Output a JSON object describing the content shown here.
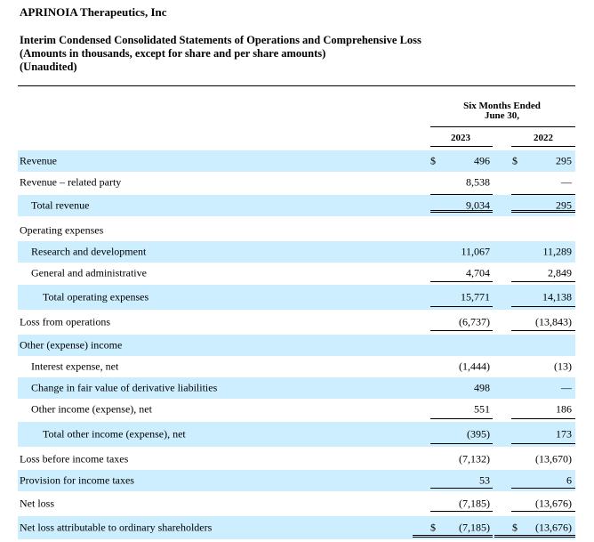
{
  "header": {
    "company": "APRINOIA Therapeutics, Inc",
    "title": "Interim Condensed Consolidated Statements of Operations and Comprehensive Loss",
    "subtitle": "(Amounts in thousands, except for share and per share amounts)",
    "note": "(Unaudited)"
  },
  "columns": {
    "period_line1": "Six Months Ended",
    "period_line2": "June 30,",
    "year1": "2023",
    "year2": "2022"
  },
  "rows": [
    {
      "label": "Revenue",
      "cur1": "$",
      "v1": "496",
      "cur2": "$",
      "v2": "295"
    },
    {
      "label": "Revenue – related party",
      "v1": "8,538",
      "v2": "—"
    },
    {
      "label": "Total revenue",
      "v1": "9,034",
      "v2": "295"
    },
    {
      "label": "Operating expenses",
      "v1": "",
      "v2": ""
    },
    {
      "label": "Research and development",
      "v1": "11,067",
      "v2": "11,289"
    },
    {
      "label": "General and administrative",
      "v1": "4,704",
      "v2": "2,849"
    },
    {
      "label": "Total operating expenses",
      "v1": "15,771",
      "v2": "14,138"
    },
    {
      "label": "Loss from operations",
      "v1": "(6,737)",
      "v2": "(13,843)"
    },
    {
      "label": "Other (expense) income",
      "v1": "",
      "v2": ""
    },
    {
      "label": "Interest expense, net",
      "v1": "(1,444)",
      "v2": "(13)"
    },
    {
      "label": "Change in fair value of derivative liabilities",
      "v1": "498",
      "v2": "—"
    },
    {
      "label": "Other income (expense), net",
      "v1": "551",
      "v2": "186"
    },
    {
      "label": "Total other income (expense), net",
      "v1": "(395)",
      "v2": "173"
    },
    {
      "label": "Loss before income taxes",
      "v1": "(7,132)",
      "v2": "(13,670)"
    },
    {
      "label": "Provision for income taxes",
      "v1": "53",
      "v2": "6"
    },
    {
      "label": "Net loss",
      "v1": "(7,185)",
      "v2": "(13,676)"
    },
    {
      "label": "Net loss attributable to ordinary shareholders",
      "cur1": "$",
      "v1": "(7,185)",
      "cur2": "$",
      "v2": "(13,676)"
    }
  ]
}
